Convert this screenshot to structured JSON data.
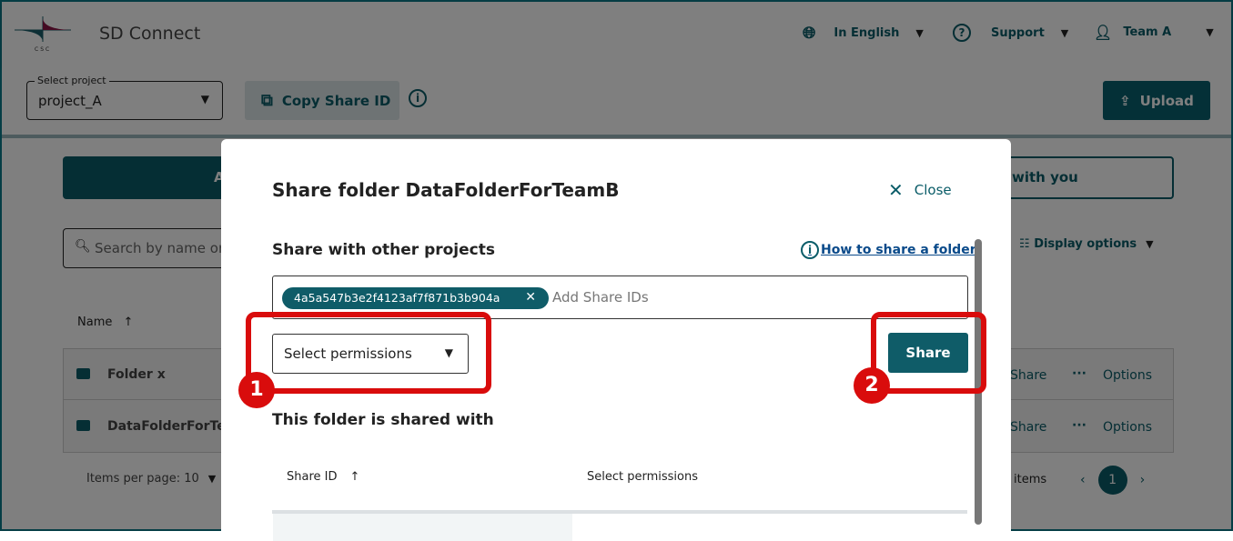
{
  "header": {
    "app_name": "SD Connect",
    "logo_text": "CSC",
    "language": "In English",
    "support": "Support",
    "user": "Team A"
  },
  "toolbar": {
    "project_label": "Select project",
    "project_value": "project_A",
    "copy_share_id": "Copy Share ID",
    "upload": "Upload"
  },
  "tabs": {
    "active_partial": "A",
    "other_partial": "with you"
  },
  "search": {
    "placeholder": "Search by name or"
  },
  "display_options": "Display options",
  "table": {
    "name_header": "Name",
    "rows": [
      {
        "name": "Folder x",
        "share": "Share",
        "options": "Options"
      },
      {
        "name": "DataFolderForTea",
        "share": "Share",
        "options": "Options"
      }
    ]
  },
  "pagination": {
    "items_per_page": "Items per page: 10",
    "items": "items",
    "current_page": "1"
  },
  "modal": {
    "title": "Share folder DataFolderForTeamB",
    "close": "Close",
    "share_with": "Share with other projects",
    "how_to": "How to share a folder",
    "chip": "4a5a547b3e2f4123af7f871b3b904a",
    "add_placeholder": "Add Share IDs",
    "permissions": "Select permissions",
    "share_button": "Share",
    "shared_with": "This folder is shared with",
    "col_share_id": "Share ID",
    "col_permissions": "Select permissions"
  },
  "annotations": [
    "1",
    "2"
  ],
  "colors": {
    "accent": "#0f5c68",
    "highlight": "#d90c0c"
  }
}
